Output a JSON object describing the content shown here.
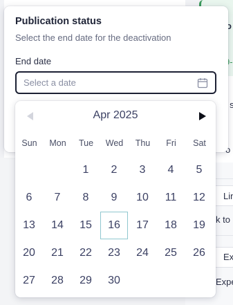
{
  "background": {
    "fragments": [
      "ro",
      "ll",
      "9-",
      "y s",
      "o",
      "Lin",
      "k to",
      "Ex",
      "Expe"
    ]
  },
  "popover": {
    "title": "Publication status",
    "subtitle": "Select the end date for the deactivation",
    "field_label": "End date",
    "input_placeholder": "Select a date",
    "input_value": ""
  },
  "calendar": {
    "month_label": "Apr 2025",
    "prev_enabled": false,
    "next_enabled": true,
    "weekdays": [
      "Sun",
      "Mon",
      "Tue",
      "Wed",
      "Thu",
      "Fri",
      "Sat"
    ],
    "first_weekday_index": 2,
    "days": [
      "1",
      "2",
      "3",
      "4",
      "5",
      "6",
      "7",
      "8",
      "9",
      "10",
      "11",
      "12",
      "13",
      "14",
      "15",
      "16",
      "17",
      "18",
      "19",
      "20",
      "21",
      "22",
      "23",
      "24",
      "25",
      "26",
      "27",
      "28",
      "29",
      "30"
    ],
    "highlighted_day": "16",
    "highlight_color": "#8fc7cf",
    "accent_text_color": "#3b4063"
  }
}
